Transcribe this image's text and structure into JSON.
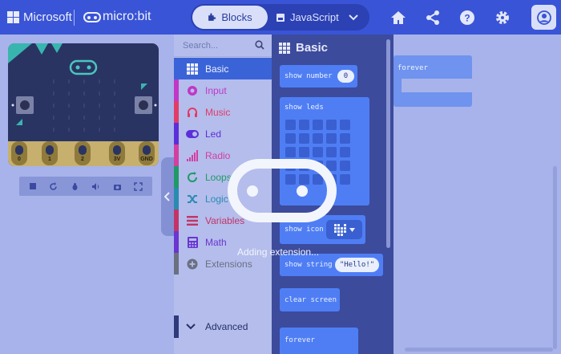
{
  "header": {
    "brand": "Microsoft",
    "product": "micro:bit",
    "tabs": [
      {
        "label": "Blocks",
        "active": true
      },
      {
        "label": "JavaScript",
        "active": false
      }
    ],
    "icons": [
      "home-icon",
      "share-icon",
      "help-icon",
      "settings-icon",
      "account-icon"
    ]
  },
  "simulator": {
    "pins": [
      "0",
      "1",
      "2",
      "3V",
      "GND"
    ],
    "buttons": {
      "a": "A",
      "b": "B"
    },
    "controls": [
      "stop",
      "restart",
      "debug",
      "mute",
      "screenshot",
      "fullscreen"
    ]
  },
  "toolbox": {
    "search_placeholder": "Search...",
    "categories": [
      {
        "label": "Basic",
        "color": "#3b63d8",
        "selected": true
      },
      {
        "label": "Input",
        "color": "#c137c6"
      },
      {
        "label": "Music",
        "color": "#e23b67"
      },
      {
        "label": "Led",
        "color": "#5c2ed8"
      },
      {
        "label": "Radio",
        "color": "#d33ea1"
      },
      {
        "label": "Loops",
        "color": "#1f9a66"
      },
      {
        "label": "Logic",
        "color": "#2a8bb0"
      },
      {
        "label": "Variables",
        "color": "#c23468"
      },
      {
        "label": "Math",
        "color": "#6a35d0"
      },
      {
        "label": "Extensions",
        "color": "#6b7080"
      }
    ],
    "advanced_label": "Advanced"
  },
  "flyout": {
    "title": "Basic",
    "blocks": {
      "show_number": "show number",
      "show_number_value": "0",
      "show_leds": "show leds",
      "show_icon": "show icon",
      "show_string": "show string",
      "show_string_value": "\"Hello!\"",
      "clear_screen": "clear screen",
      "forever": "forever"
    }
  },
  "workspace": {
    "forever_block_label": "forever"
  },
  "overlay": {
    "message": "Adding extension..."
  },
  "colors": {
    "header_bg": "#3954d6",
    "block_blue": "#4f7ef4",
    "overlay_tint": "#a7b3ea"
  }
}
